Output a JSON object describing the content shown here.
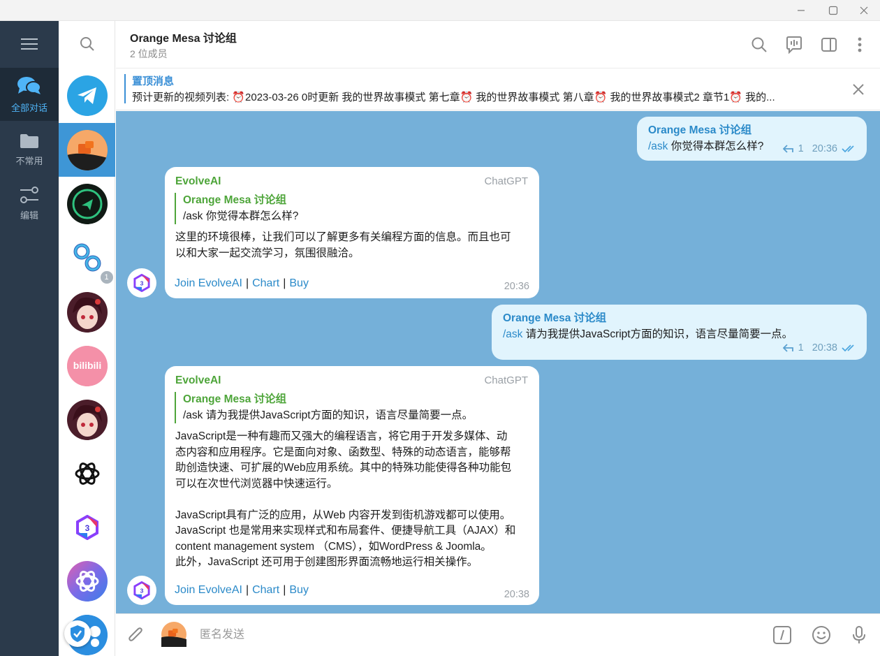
{
  "window": {
    "minimize_icon": "minimize-icon",
    "maximize_icon": "maximize-icon",
    "close_icon": "close-icon"
  },
  "folders": [
    {
      "label": "全部对话",
      "icon": "chats-icon",
      "active": true
    },
    {
      "label": "不常用",
      "icon": "folder-icon",
      "active": false
    },
    {
      "label": "编辑",
      "icon": "edit-sliders-icon",
      "active": false
    }
  ],
  "chat_list": [
    {
      "name": "telegram",
      "icon": "telegram-logo",
      "bg": "#2ba4e4"
    },
    {
      "name": "orange-mesa",
      "icon": "orange-mesa-avatar",
      "bg": "#f28c2e",
      "active": true
    },
    {
      "name": "r2-chat",
      "icon": "r2-avatar",
      "bg": "#101a14"
    },
    {
      "name": "link-bot",
      "icon": "link-avatar",
      "bg": "#ffffff",
      "unread": "1"
    },
    {
      "name": "anime-girl-1",
      "icon": "anime-avatar",
      "bg": "#5a2330"
    },
    {
      "name": "bilibili",
      "icon": "bilibili-avatar",
      "bg": "#f08aa0"
    },
    {
      "name": "anime-girl-2",
      "icon": "anime-avatar",
      "bg": "#5a2330"
    },
    {
      "name": "openai",
      "icon": "openai-logo",
      "bg": "#ffffff"
    },
    {
      "name": "evolveai",
      "icon": "evolveai-logo",
      "bg": "#ffffff"
    },
    {
      "name": "gpt-gradient",
      "icon": "openai-gradient-logo",
      "bg": "#9a6ad8"
    },
    {
      "name": "more-bot",
      "icon": "bot-avatar",
      "bg": "#2b8ee0"
    }
  ],
  "header": {
    "title": "Orange Mesa 讨论组",
    "subtitle": "2 位成员"
  },
  "pinned": {
    "title": "置顶消息",
    "text": "预计更新的视频列表: ⏰2023-03-26 0时更新  我的世界故事模式 第七章⏰ 我的世界故事模式 第八章⏰ 我的世界故事模式2 章节1⏰ 我的..."
  },
  "messages": [
    {
      "sender": "Orange Mesa 讨论组",
      "cmd": "/ask",
      "text": " 你觉得本群怎么样?",
      "replies": "1",
      "time": "20:36"
    },
    {
      "sender": "EvolveAI",
      "via": "ChatGPT",
      "reply_sender": "Orange Mesa 讨论组",
      "reply_text": "/ask 你觉得本群怎么样?",
      "body": [
        "这里的环境很棒，让我们可以了解更多有关编程方面的信息。而且也可",
        "以和大家一起交流学习，氛围很融洽。"
      ],
      "buttons": [
        "Join EvolveAI",
        "Chart",
        "Buy"
      ],
      "time": "20:36"
    },
    {
      "sender": "Orange Mesa 讨论组",
      "cmd": "/ask",
      "text": " 请为我提供JavaScript方面的知识，语言尽量简要一点。",
      "replies": "1",
      "time": "20:38"
    },
    {
      "sender": "EvolveAI",
      "via": "ChatGPT",
      "reply_sender": "Orange Mesa 讨论组",
      "reply_text": "/ask 请为我提供JavaScript方面的知识，语言尽量简要一点。",
      "body": [
        "JavaScript是一种有趣而又强大的编程语言，将它用于开发多媒体、动",
        "态内容和应用程序。它是面向对象、函数型、特殊的动态语言，能够帮",
        "助创造快速、可扩展的Web应用系统。其中的特殊功能使得各种功能包",
        "可以在次世代浏览器中快速运行。",
        "",
        "JavaScript具有广泛的应用，从Web 内容开发到街机游戏都可以使用。",
        "JavaScript 也是常用来实现样式和布局套件、便捷导航工具（AJAX）和",
        "content management system （CMS），如WordPress & Joomla。",
        "此外，JavaScript 还可用于创建图形界面流畅地运行相关操作。"
      ],
      "buttons": [
        "Join EvolveAI",
        "Chart",
        "Buy"
      ],
      "time": "20:38"
    }
  ],
  "composer": {
    "placeholder": "匿名发送"
  },
  "colors": {
    "accent": "#3e96d6",
    "chat_bg": "#75b0d9",
    "sidebar": "#2b3a4b",
    "outgoing": "#e1f4fd",
    "green_name": "#4ea53a"
  }
}
